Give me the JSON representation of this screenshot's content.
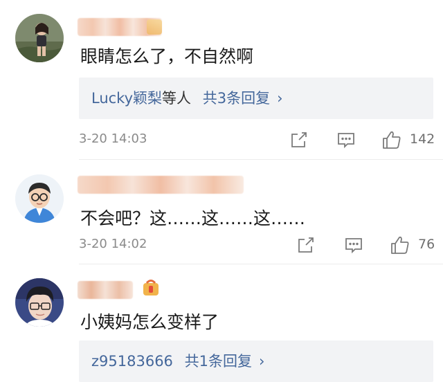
{
  "comments": [
    {
      "text": "眼睛怎么了，不自然啊",
      "reply": {
        "users": "Lucky颖梨",
        "suffix": "等人",
        "count_label": "共3条回复"
      },
      "time": "3-20 14:03",
      "likes": "142"
    },
    {
      "text": "不会吧？这……这……这……",
      "time": "3-20 14:02",
      "likes": "76"
    },
    {
      "text": "小姨妈怎么变样了",
      "reply": {
        "users": "z95183666",
        "count_label": "共1条回复"
      }
    }
  ],
  "icons": {
    "share": "share-icon",
    "comment": "comment-icon",
    "like": "thumbs-up-icon",
    "chevron": "chevron-right-icon",
    "vip": "vip-badge-icon"
  },
  "colors": {
    "link": "#44679b",
    "meta": "#8a8a8a",
    "reply_bg": "#f2f3f5"
  }
}
